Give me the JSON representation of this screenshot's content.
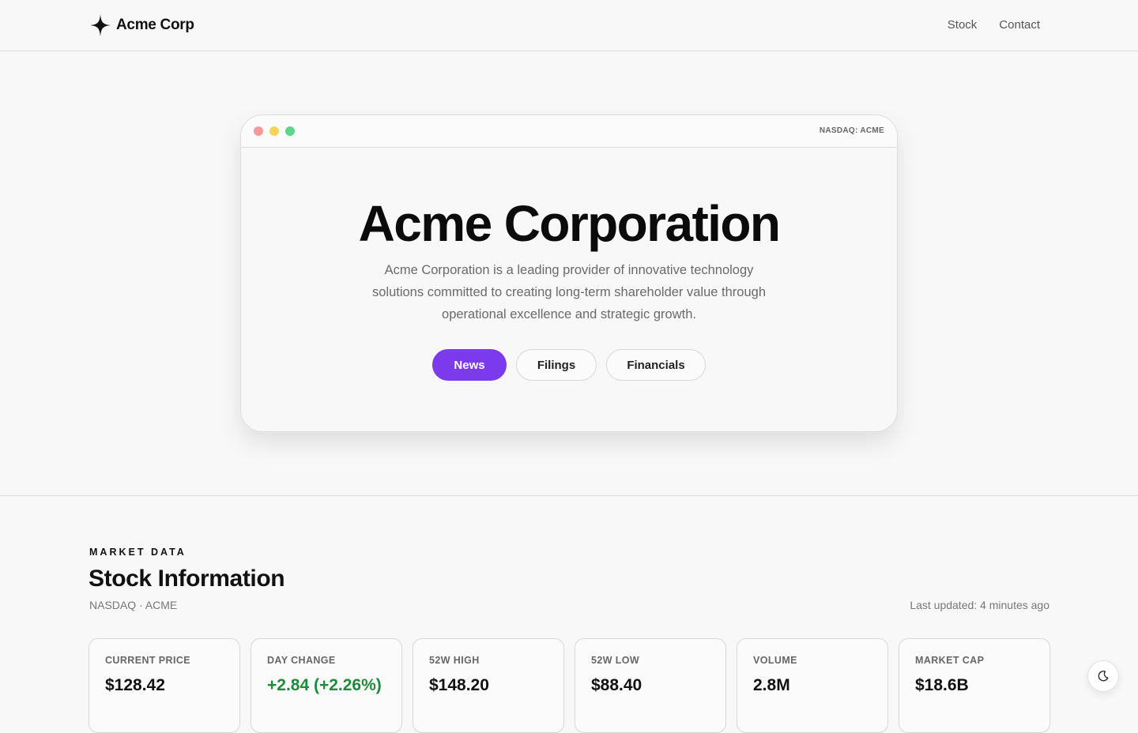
{
  "header": {
    "brand": "Acme Corp",
    "nav": [
      "Stock",
      "Contact"
    ]
  },
  "hero": {
    "ticker": "NASDAQ: ACME",
    "title": "Acme Corporation",
    "description": "Acme Corporation is a leading provider of innovative technology solutions committed to creating long-term shareholder value through operational excellence and strategic growth.",
    "buttons": [
      "News",
      "Filings",
      "Financials"
    ]
  },
  "market": {
    "eyebrow": "MARKET DATA",
    "title": "Stock Information",
    "subtitle": "NASDAQ · ACME",
    "updated": "Last updated: 4 minutes ago",
    "stats": [
      {
        "label": "CURRENT PRICE",
        "value": "$128.42"
      },
      {
        "label": "DAY CHANGE",
        "value": "+2.84 (+2.26%)"
      },
      {
        "label": "52W HIGH",
        "value": "$148.20"
      },
      {
        "label": "52W LOW",
        "value": "$88.40"
      },
      {
        "label": "VOLUME",
        "value": "2.8M"
      },
      {
        "label": "MARKET CAP",
        "value": "$18.6B"
      }
    ]
  },
  "colors": {
    "accent": "#7c3aed",
    "positive": "#1f8a3b"
  },
  "icons": {
    "brand": "sparkle-icon",
    "theme_toggle": "moon-icon"
  }
}
